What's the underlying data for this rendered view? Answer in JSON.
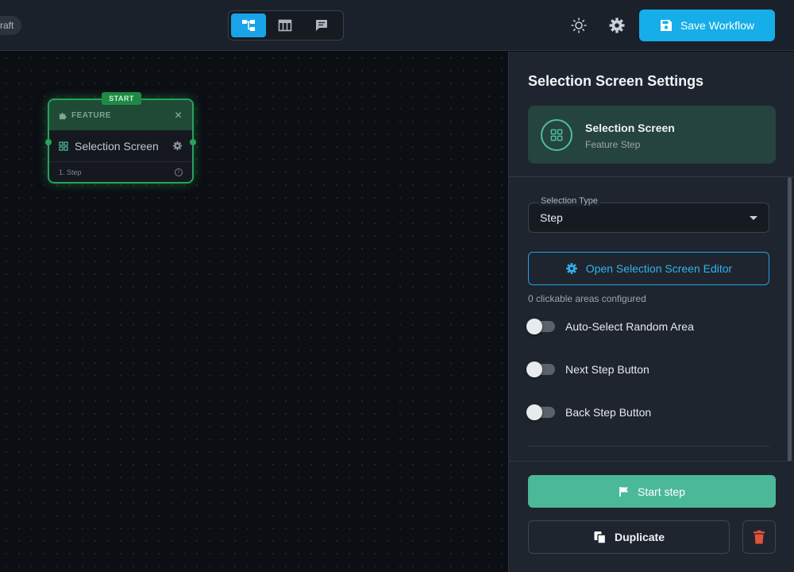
{
  "header": {
    "draft_badge": "raft",
    "views": [
      {
        "icon": "flow-view-icon",
        "active": true
      },
      {
        "icon": "table-view-icon",
        "active": false
      },
      {
        "icon": "comments-view-icon",
        "active": false
      }
    ],
    "theme_icon": "sun-icon",
    "settings_icon": "gear-icon",
    "save_label": "Save Workflow"
  },
  "canvas": {
    "node": {
      "badge": "START",
      "type_label": "FEATURE",
      "title": "Selection Screen",
      "footer": "1. Step"
    }
  },
  "panel": {
    "title": "Selection Screen Settings",
    "card": {
      "title": "Selection Screen",
      "subtitle": "Feature Step"
    },
    "selection_type": {
      "label": "Selection Type",
      "value": "Step"
    },
    "editor_button": "Open Selection Screen Editor",
    "clickable_note": "0 clickable areas configured",
    "toggles": [
      {
        "label": "Auto-Select Random Area",
        "on": false
      },
      {
        "label": "Next Step Button",
        "on": false
      },
      {
        "label": "Back Step Button",
        "on": false
      }
    ],
    "start_button": "Start step",
    "duplicate_button": "Duplicate"
  },
  "colors": {
    "accent_blue": "#16aee8",
    "accent_green": "#4bb999",
    "node_border": "#27a35a",
    "danger": "#e0533a"
  }
}
